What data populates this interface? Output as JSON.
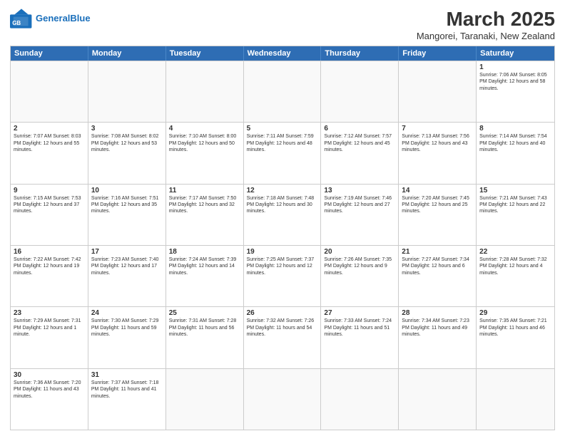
{
  "header": {
    "logo_general": "General",
    "logo_blue": "Blue",
    "title": "March 2025",
    "subtitle": "Mangorei, Taranaki, New Zealand"
  },
  "days_of_week": [
    "Sunday",
    "Monday",
    "Tuesday",
    "Wednesday",
    "Thursday",
    "Friday",
    "Saturday"
  ],
  "weeks": [
    [
      {
        "day": "",
        "info": ""
      },
      {
        "day": "",
        "info": ""
      },
      {
        "day": "",
        "info": ""
      },
      {
        "day": "",
        "info": ""
      },
      {
        "day": "",
        "info": ""
      },
      {
        "day": "",
        "info": ""
      },
      {
        "day": "1",
        "info": "Sunrise: 7:06 AM\nSunset: 8:05 PM\nDaylight: 12 hours\nand 58 minutes."
      }
    ],
    [
      {
        "day": "2",
        "info": "Sunrise: 7:07 AM\nSunset: 8:03 PM\nDaylight: 12 hours\nand 55 minutes."
      },
      {
        "day": "3",
        "info": "Sunrise: 7:08 AM\nSunset: 8:02 PM\nDaylight: 12 hours\nand 53 minutes."
      },
      {
        "day": "4",
        "info": "Sunrise: 7:10 AM\nSunset: 8:00 PM\nDaylight: 12 hours\nand 50 minutes."
      },
      {
        "day": "5",
        "info": "Sunrise: 7:11 AM\nSunset: 7:59 PM\nDaylight: 12 hours\nand 48 minutes."
      },
      {
        "day": "6",
        "info": "Sunrise: 7:12 AM\nSunset: 7:57 PM\nDaylight: 12 hours\nand 45 minutes."
      },
      {
        "day": "7",
        "info": "Sunrise: 7:13 AM\nSunset: 7:56 PM\nDaylight: 12 hours\nand 43 minutes."
      },
      {
        "day": "8",
        "info": "Sunrise: 7:14 AM\nSunset: 7:54 PM\nDaylight: 12 hours\nand 40 minutes."
      }
    ],
    [
      {
        "day": "9",
        "info": "Sunrise: 7:15 AM\nSunset: 7:53 PM\nDaylight: 12 hours\nand 37 minutes."
      },
      {
        "day": "10",
        "info": "Sunrise: 7:16 AM\nSunset: 7:51 PM\nDaylight: 12 hours\nand 35 minutes."
      },
      {
        "day": "11",
        "info": "Sunrise: 7:17 AM\nSunset: 7:50 PM\nDaylight: 12 hours\nand 32 minutes."
      },
      {
        "day": "12",
        "info": "Sunrise: 7:18 AM\nSunset: 7:48 PM\nDaylight: 12 hours\nand 30 minutes."
      },
      {
        "day": "13",
        "info": "Sunrise: 7:19 AM\nSunset: 7:46 PM\nDaylight: 12 hours\nand 27 minutes."
      },
      {
        "day": "14",
        "info": "Sunrise: 7:20 AM\nSunset: 7:45 PM\nDaylight: 12 hours\nand 25 minutes."
      },
      {
        "day": "15",
        "info": "Sunrise: 7:21 AM\nSunset: 7:43 PM\nDaylight: 12 hours\nand 22 minutes."
      }
    ],
    [
      {
        "day": "16",
        "info": "Sunrise: 7:22 AM\nSunset: 7:42 PM\nDaylight: 12 hours\nand 19 minutes."
      },
      {
        "day": "17",
        "info": "Sunrise: 7:23 AM\nSunset: 7:40 PM\nDaylight: 12 hours\nand 17 minutes."
      },
      {
        "day": "18",
        "info": "Sunrise: 7:24 AM\nSunset: 7:39 PM\nDaylight: 12 hours\nand 14 minutes."
      },
      {
        "day": "19",
        "info": "Sunrise: 7:25 AM\nSunset: 7:37 PM\nDaylight: 12 hours\nand 12 minutes."
      },
      {
        "day": "20",
        "info": "Sunrise: 7:26 AM\nSunset: 7:35 PM\nDaylight: 12 hours\nand 9 minutes."
      },
      {
        "day": "21",
        "info": "Sunrise: 7:27 AM\nSunset: 7:34 PM\nDaylight: 12 hours\nand 6 minutes."
      },
      {
        "day": "22",
        "info": "Sunrise: 7:28 AM\nSunset: 7:32 PM\nDaylight: 12 hours\nand 4 minutes."
      }
    ],
    [
      {
        "day": "23",
        "info": "Sunrise: 7:29 AM\nSunset: 7:31 PM\nDaylight: 12 hours\nand 1 minute."
      },
      {
        "day": "24",
        "info": "Sunrise: 7:30 AM\nSunset: 7:29 PM\nDaylight: 11 hours\nand 59 minutes."
      },
      {
        "day": "25",
        "info": "Sunrise: 7:31 AM\nSunset: 7:28 PM\nDaylight: 11 hours\nand 56 minutes."
      },
      {
        "day": "26",
        "info": "Sunrise: 7:32 AM\nSunset: 7:26 PM\nDaylight: 11 hours\nand 54 minutes."
      },
      {
        "day": "27",
        "info": "Sunrise: 7:33 AM\nSunset: 7:24 PM\nDaylight: 11 hours\nand 51 minutes."
      },
      {
        "day": "28",
        "info": "Sunrise: 7:34 AM\nSunset: 7:23 PM\nDaylight: 11 hours\nand 49 minutes."
      },
      {
        "day": "29",
        "info": "Sunrise: 7:35 AM\nSunset: 7:21 PM\nDaylight: 11 hours\nand 46 minutes."
      }
    ],
    [
      {
        "day": "30",
        "info": "Sunrise: 7:36 AM\nSunset: 7:20 PM\nDaylight: 11 hours\nand 43 minutes."
      },
      {
        "day": "31",
        "info": "Sunrise: 7:37 AM\nSunset: 7:18 PM\nDaylight: 11 hours\nand 41 minutes."
      },
      {
        "day": "",
        "info": ""
      },
      {
        "day": "",
        "info": ""
      },
      {
        "day": "",
        "info": ""
      },
      {
        "day": "",
        "info": ""
      },
      {
        "day": "",
        "info": ""
      }
    ]
  ]
}
